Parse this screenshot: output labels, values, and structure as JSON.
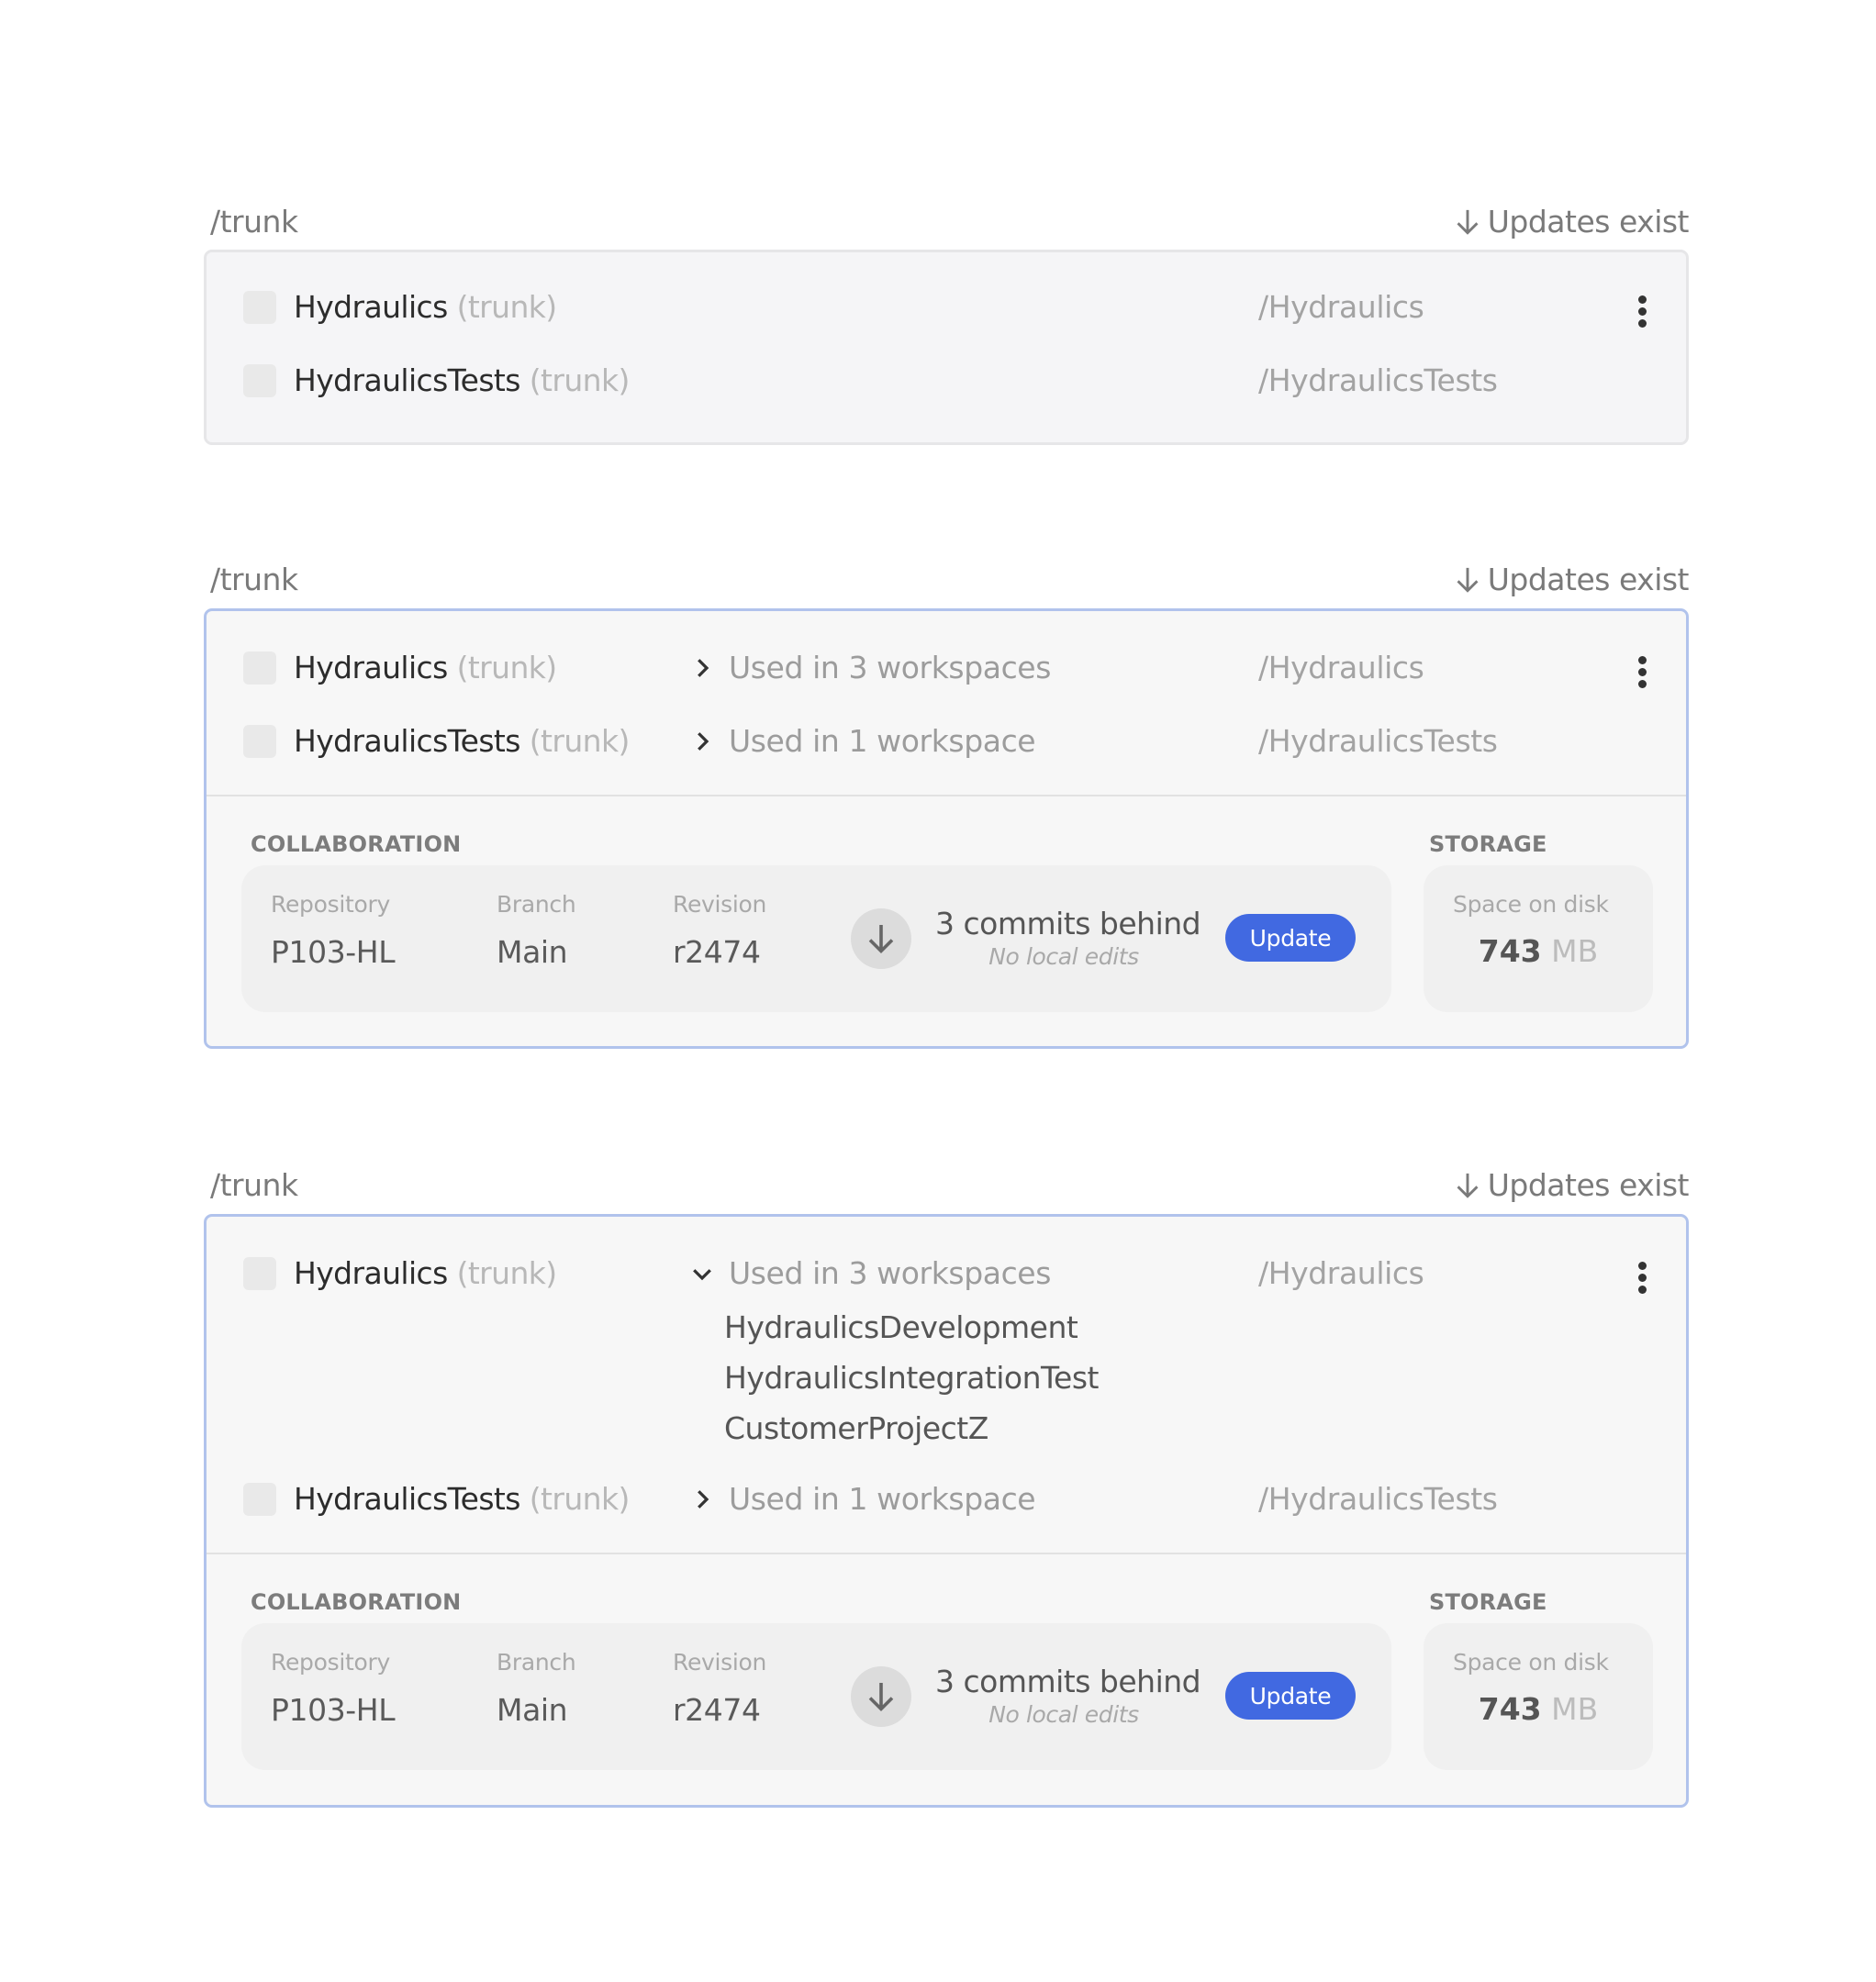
{
  "colors": {
    "accent": "#4169e1",
    "selected_border": "#b1c3ec",
    "card_border": "#e6e6e8"
  },
  "groups": [
    {
      "path": "/trunk",
      "updates_label": "Updates exist",
      "selected": false,
      "items": [
        {
          "name": "Hydraulics",
          "branch": "(trunk)",
          "path": "/Hydraulics"
        },
        {
          "name": "HydraulicsTests",
          "branch": "(trunk)",
          "path": "/HydraulicsTests"
        }
      ]
    },
    {
      "path": "/trunk",
      "updates_label": "Updates exist",
      "selected": true,
      "items": [
        {
          "name": "Hydraulics",
          "branch": "(trunk)",
          "usage": "Used in 3 workspaces",
          "expanded": false,
          "path": "/Hydraulics"
        },
        {
          "name": "HydraulicsTests",
          "branch": "(trunk)",
          "usage": "Used in 1 workspace",
          "expanded": false,
          "path": "/HydraulicsTests"
        }
      ],
      "collaboration": {
        "section_label": "COLLABORATION",
        "repository_label": "Repository",
        "repository": "P103-HL",
        "branch_label": "Branch",
        "branch": "Main",
        "revision_label": "Revision",
        "revision": "r2474",
        "status": "3 commits behind",
        "substatus": "No local edits",
        "update_button": "Update"
      },
      "storage": {
        "section_label": "STORAGE",
        "label": "Space on disk",
        "value": "743",
        "unit": "MB"
      }
    },
    {
      "path": "/trunk",
      "updates_label": "Updates exist",
      "selected": true,
      "items": [
        {
          "name": "Hydraulics",
          "branch": "(trunk)",
          "usage": "Used in 3 workspaces",
          "expanded": true,
          "path": "/Hydraulics",
          "workspaces": [
            "HydraulicsDevelopment",
            "HydraulicsIntegrationTest",
            "CustomerProjectZ"
          ]
        },
        {
          "name": "HydraulicsTests",
          "branch": "(trunk)",
          "usage": "Used in 1 workspace",
          "expanded": false,
          "path": "/HydraulicsTests"
        }
      ],
      "collaboration": {
        "section_label": "COLLABORATION",
        "repository_label": "Repository",
        "repository": "P103-HL",
        "branch_label": "Branch",
        "branch": "Main",
        "revision_label": "Revision",
        "revision": "r2474",
        "status": "3 commits behind",
        "substatus": "No local edits",
        "update_button": "Update"
      },
      "storage": {
        "section_label": "STORAGE",
        "label": "Space on disk",
        "value": "743",
        "unit": "MB"
      }
    }
  ]
}
